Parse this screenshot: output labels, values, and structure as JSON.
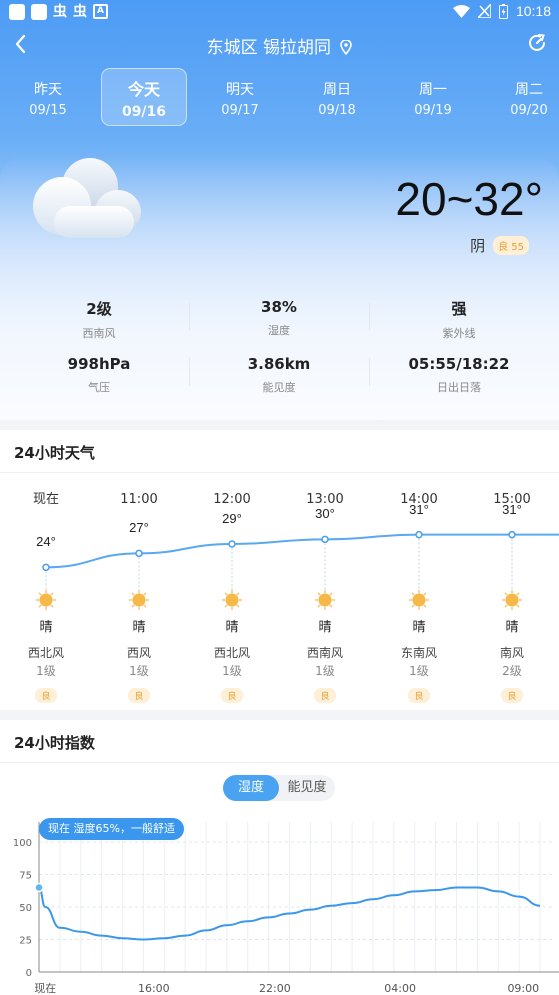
{
  "status_bar": {
    "time": "10:18",
    "left_icons": [
      "app-icon",
      "app-icon",
      "bug-icon",
      "bug-icon",
      "a-icon"
    ],
    "left_glyph": "虫",
    "a_glyph": "A"
  },
  "header": {
    "location": "东城区 锡拉胡同",
    "back_icon": "chevron-left-icon",
    "refresh_icon": "refresh-icon"
  },
  "days": [
    {
      "name": "昨天",
      "date": "09/15",
      "active": false
    },
    {
      "name": "今天",
      "date": "09/16",
      "active": true
    },
    {
      "name": "明天",
      "date": "09/17",
      "active": false
    },
    {
      "name": "周日",
      "date": "09/18",
      "active": false
    },
    {
      "name": "周一",
      "date": "09/19",
      "active": false
    },
    {
      "name": "周二",
      "date": "09/20",
      "active": false
    }
  ],
  "current": {
    "temp_range": "20~32°",
    "condition": "阴",
    "aqi": "良 55",
    "stats": [
      {
        "value": "2级",
        "label": "西南风"
      },
      {
        "value": "38%",
        "label": "湿度"
      },
      {
        "value": "强",
        "label": "紫外线"
      },
      {
        "value": "998hPa",
        "label": "气压"
      },
      {
        "value": "3.86km",
        "label": "能见度"
      },
      {
        "value": "05:55/18:22",
        "label": "日出日落"
      }
    ]
  },
  "hourly": {
    "title": "24小时天气",
    "items": [
      {
        "time": "现在",
        "temp": "24°",
        "temp_value": 24,
        "cond": "晴",
        "wind_dir": "西北风",
        "wind_level": "1级",
        "aqi": "良"
      },
      {
        "time": "11:00",
        "temp": "27°",
        "temp_value": 27,
        "cond": "晴",
        "wind_dir": "西风",
        "wind_level": "1级",
        "aqi": "良"
      },
      {
        "time": "12:00",
        "temp": "29°",
        "temp_value": 29,
        "cond": "晴",
        "wind_dir": "西北风",
        "wind_level": "1级",
        "aqi": "良"
      },
      {
        "time": "13:00",
        "temp": "30°",
        "temp_value": 30,
        "cond": "晴",
        "wind_dir": "西南风",
        "wind_level": "1级",
        "aqi": "良"
      },
      {
        "time": "14:00",
        "temp": "31°",
        "temp_value": 31,
        "cond": "晴",
        "wind_dir": "东南风",
        "wind_level": "1级",
        "aqi": "良"
      },
      {
        "time": "15:00",
        "temp": "31°",
        "temp_value": 31,
        "cond": "晴",
        "wind_dir": "南风",
        "wind_level": "2级",
        "aqi": "良"
      }
    ]
  },
  "index": {
    "title": "24小时指数",
    "tabs": [
      "湿度",
      "能见度"
    ],
    "active_tab": "湿度",
    "callout": "现在 湿度65%，一般舒适"
  },
  "chart_data": {
    "type": "line",
    "series": [
      {
        "x": [
          0,
          0.3,
          1,
          2,
          3,
          4,
          5,
          6,
          7,
          8,
          9,
          10,
          11,
          12,
          13,
          14,
          15,
          16,
          17,
          18,
          19,
          20,
          21,
          22,
          23,
          24
        ],
        "values": [
          65,
          50,
          34,
          31,
          28,
          26,
          25,
          26,
          28,
          32,
          36,
          39,
          42,
          45,
          48,
          51,
          53,
          56,
          59,
          62,
          63,
          65,
          65,
          62,
          58,
          51
        ]
      }
    ],
    "ylim": [
      0,
      100
    ],
    "yticks": [
      "0",
      "25",
      "50",
      "75",
      "100"
    ],
    "xtick_labels": [
      "现在",
      "16:00",
      "22:00",
      "04:00",
      "09:00"
    ],
    "grid": true
  }
}
